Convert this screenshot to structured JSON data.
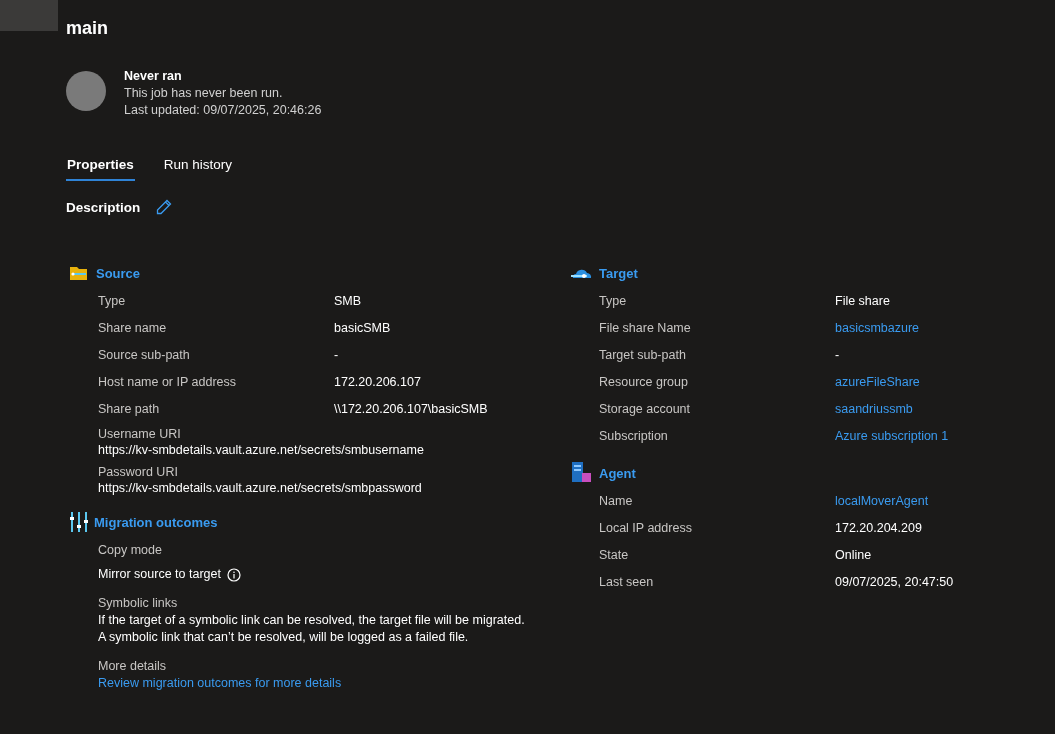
{
  "title": "main",
  "status": {
    "heading": "Never ran",
    "message": "This job has never been run.",
    "updated": "Last updated: 09/07/2025, 20:46:26"
  },
  "tabs": [
    {
      "label": "Properties",
      "selected": true
    },
    {
      "label": "Run history",
      "selected": false
    }
  ],
  "description": {
    "label": "Description"
  },
  "source": {
    "title": "Source",
    "rows": [
      {
        "kind": "pair",
        "label": "Type",
        "value": "SMB"
      },
      {
        "kind": "pair",
        "label": "Share name",
        "value": "basicSMB"
      },
      {
        "kind": "pair",
        "label": "Source sub-path",
        "value": "-"
      },
      {
        "kind": "pair",
        "label": "Host name or IP address",
        "value": "172.20.206.107"
      },
      {
        "kind": "pair",
        "label": "Share path",
        "value": "\\\\172.20.206.107\\basicSMB"
      },
      {
        "kind": "stacked",
        "label": "Username URI",
        "value": "https://kv-smbdetails.vault.azure.net/secrets/smbusername"
      },
      {
        "kind": "stacked",
        "label": "Password URI",
        "value": "https://kv-smbdetails.vault.azure.net/secrets/smbpassword"
      }
    ]
  },
  "migration": {
    "title": "Migration outcomes",
    "rows": [
      {
        "kind": "info",
        "label": "Copy mode",
        "value": "Mirror source to target"
      },
      {
        "kind": "paragraph",
        "label": "Symbolic links",
        "lines": [
          "If the target of a symbolic link can be resolved, the target file will be migrated.",
          "A symbolic link that can’t be resolved, will be logged as a failed file."
        ]
      },
      {
        "kind": "link",
        "label": "More details",
        "value": "Review migration outcomes for more details"
      }
    ]
  },
  "target": {
    "title": "Target",
    "rows": [
      {
        "kind": "pair",
        "label": "Type",
        "value": "File share"
      },
      {
        "kind": "link",
        "label": "File share Name",
        "value": "basicsmbazure"
      },
      {
        "kind": "pair",
        "label": "Target sub-path",
        "value": "-"
      },
      {
        "kind": "link",
        "label": "Resource group",
        "value": "azureFileShare"
      },
      {
        "kind": "link",
        "label": "Storage account",
        "value": "saandriussmb"
      },
      {
        "kind": "link",
        "label": "Subscription",
        "value": "Azure subscription 1"
      }
    ]
  },
  "agent": {
    "title": "Agent",
    "rows": [
      {
        "kind": "link",
        "label": "Name",
        "value": "localMoverAgent"
      },
      {
        "kind": "pair",
        "label": "Local IP address",
        "value": "172.20.204.209"
      },
      {
        "kind": "pair",
        "label": "State",
        "value": "Online"
      },
      {
        "kind": "pair",
        "label": "Last seen",
        "value": "09/07/2025, 20:47:50"
      }
    ]
  }
}
